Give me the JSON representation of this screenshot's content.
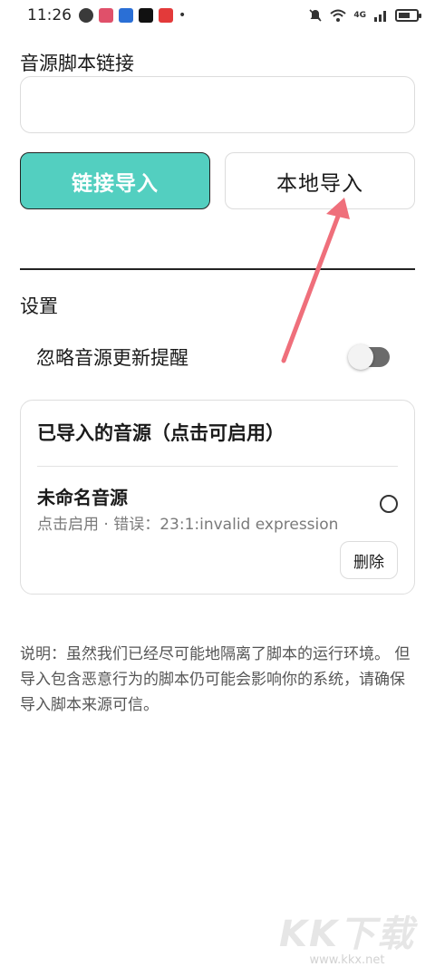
{
  "status_bar": {
    "time": "11:26",
    "network_label": "4G"
  },
  "import": {
    "url_section_label": "音源脚本链接",
    "url_value": "",
    "link_import_label": "链接导入",
    "local_import_label": "本地导入",
    "link_import_color": "#53cfc0"
  },
  "settings": {
    "section_label": "设置",
    "ignore_update_label": "忽略音源更新提醒",
    "ignore_update_enabled": false
  },
  "imported": {
    "title": "已导入的音源（点击可启用）",
    "sources": [
      {
        "name": "未命名音源",
        "status": "点击启用 · 错误：23:1:invalid expression",
        "selected": false,
        "delete_label": "删除"
      }
    ]
  },
  "note": {
    "text": "说明：虽然我们已经尽可能地隔离了脚本的运行环境。 但导入包含恶意行为的脚本仍可能会影响你的系统，请确保导入脚本来源可信。"
  },
  "annotation": {
    "arrow_color": "#ef6f7b"
  },
  "watermark": {
    "big": "KK下载",
    "small": "www.kkx.net"
  }
}
